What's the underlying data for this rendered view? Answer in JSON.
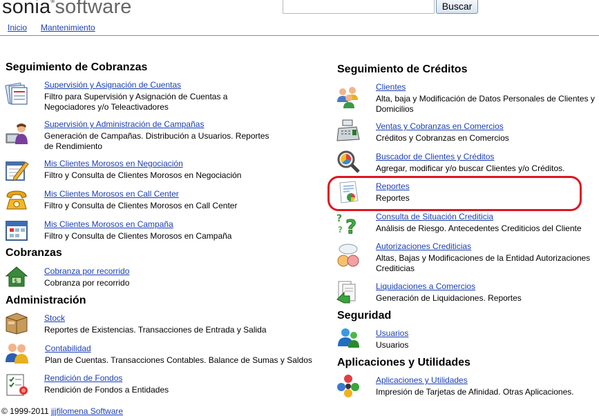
{
  "header": {
    "logo_part1": "sonia",
    "logo_reg": "®",
    "logo_part2": "software",
    "search_value": "",
    "search_button": "Buscar"
  },
  "nav": {
    "inicio": "Inicio",
    "mantenimiento": "Mantenimiento"
  },
  "left": {
    "cobranzas_seg_title": "Seguimiento de Cobranzas",
    "cobranzas_seg": [
      {
        "link": "Supervisión y Asignación de Cuentas",
        "desc": "Filtro para Supervisión y Asignación de Cuentas a Negociadores y/o Teleactivadores",
        "icon": "folders-icon"
      },
      {
        "link": "Supervisión y Administración de Campañas",
        "desc": "Generación de Campañas. Distribución a Usuarios. Reportes de Rendimiento",
        "icon": "user-computer-icon"
      },
      {
        "link": "Mis Clientes Morosos en Negociación",
        "desc": "Filtro y Consulta de Clientes Morosos en Negociación",
        "icon": "notepad-pencil-icon"
      },
      {
        "link": "Mis Clientes Morosos en Call Center",
        "desc": "Filtro y Consulta de Clientes Morosos en Call Center",
        "icon": "telephone-icon"
      },
      {
        "link": "Mis Clientes Morosos en Campaña",
        "desc": "Filtro y Consulta de Clientes Morosos en Campaña",
        "icon": "calendar-icon"
      }
    ],
    "cobranzas_title": "Cobranzas",
    "cobranzas": [
      {
        "link": "Cobranza por recorrido",
        "desc": "Cobranza por recorrido",
        "icon": "money-house-icon"
      }
    ],
    "admin_title": "Administración",
    "admin": [
      {
        "link": "Stock",
        "desc": "Reportes de Existencias. Transacciones de Entrada y Salida",
        "icon": "box-icon"
      },
      {
        "link": "Contabilidad",
        "desc": "Plan de Cuentas. Transacciones Contables. Balance de Sumas y Saldos",
        "icon": "users-icon"
      },
      {
        "link": "Rendición de Fondos",
        "desc": "Rendición de Fondos a Entidades",
        "icon": "checklist-icon"
      }
    ]
  },
  "right": {
    "creditos_title": "Seguimiento de Créditos",
    "creditos": [
      {
        "link": "Clientes",
        "desc": "Alta, baja y Modificación de Datos Personales de Clientes y Domicilios",
        "icon": "people-group-icon"
      },
      {
        "link": "Ventas y Cobranzas en Comercios",
        "desc": "Créditos y Cobranzas en Comercios",
        "icon": "cash-register-icon"
      },
      {
        "link": "Buscador de Clientes y Créditos",
        "desc": "Agregar, modificar y/o buscar Clientes y/o Créditos.",
        "icon": "magnifier-chart-icon"
      },
      {
        "link": "Reportes",
        "desc": "Reportes",
        "icon": "report-chart-icon"
      },
      {
        "link": "Consulta de Situación Crediticia",
        "desc": "Análisis de Riesgo. Antecedentes Crediticios del Cliente",
        "icon": "question-marks-icon"
      },
      {
        "link": "Autorizaciones Crediticias",
        "desc": "Altas, Bajas y Modificaciones de la Entidad Autorizaciones Crediticias",
        "icon": "speech-faces-icon"
      },
      {
        "link": "Liquidaciones a Comercios",
        "desc": "Generación de Liquidaciones. Reportes",
        "icon": "documents-arrow-icon"
      }
    ],
    "seguridad_title": "Seguridad",
    "seguridad": [
      {
        "link": "Usuarios",
        "desc": "Usuarios",
        "icon": "user-messenger-icon"
      }
    ],
    "apps_title": "Aplicaciones y Utilidades",
    "apps": [
      {
        "link": "Aplicaciones y Utilidades",
        "desc": "Impresión de Tarjetas de Afinidad. Otras Aplicaciones.",
        "icon": "molecule-icon"
      }
    ]
  },
  "footer": {
    "copyright": "© 1999-2011",
    "link": "jjjfilomena Software"
  },
  "colors": {
    "link": "#1a3fb5",
    "highlight": "#e0151f"
  }
}
